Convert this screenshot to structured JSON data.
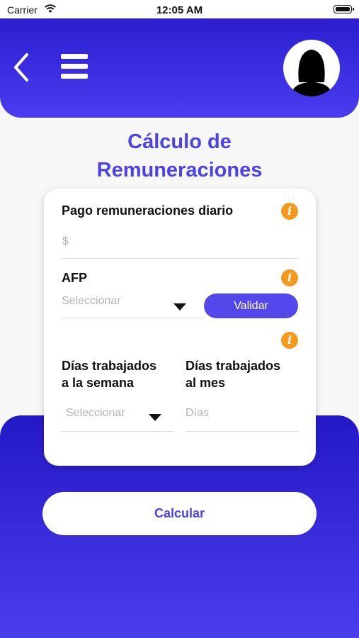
{
  "status_bar": {
    "carrier": "Carrier",
    "time": "12:05 AM"
  },
  "header": {
    "back_icon": "chevron-left-icon",
    "menu_icon": "hamburger-menu-icon",
    "avatar_icon": "user-avatar-silhouette"
  },
  "title": {
    "line1": "Cálculo de",
    "line2": "Remuneraciones"
  },
  "form": {
    "pago": {
      "label": "Pago remuneraciones diario",
      "placeholder": "$",
      "value": ""
    },
    "afp": {
      "label": "AFP",
      "placeholder": "Seleccionar",
      "validate_label": "Validar"
    },
    "dias_semana": {
      "label_line1": "Días trabajados",
      "label_line2": "a la semana",
      "placeholder": "Seleccionar"
    },
    "dias_mes": {
      "label_line1": "Días trabajados",
      "label_line2": "al mes",
      "placeholder": "Días"
    },
    "info_icon_glyph": "i"
  },
  "actions": {
    "calcular_label": "Calcular"
  },
  "colors": {
    "primary": "#4b43e6",
    "header_gradient_top": "#2a1ecf",
    "info_orange": "#f39a1e",
    "button_purple": "#5548ea"
  }
}
